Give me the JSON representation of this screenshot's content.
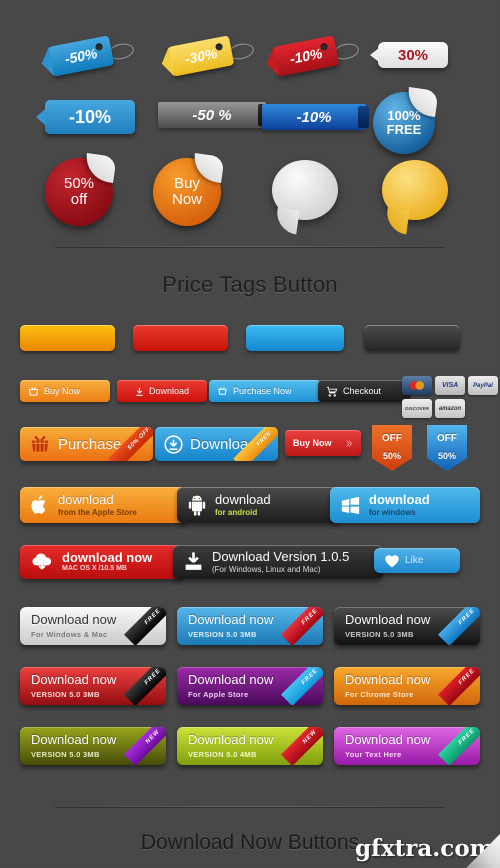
{
  "page": {
    "background_color": "#474747",
    "section_title_1": "Price Tags Button",
    "section_title_2": "Download Now Buttons",
    "watermark": "gfxtra.com"
  },
  "price_tags_row1": [
    {
      "label": "-50%",
      "color": "#1b8ed1",
      "type": "swing-tag"
    },
    {
      "label": "-30%",
      "color": "#f5cf3e",
      "type": "swing-tag"
    },
    {
      "label": "-10%",
      "color": "#cf1a22",
      "type": "swing-tag"
    },
    {
      "label": "30%",
      "color": "#ffffff",
      "type": "callout",
      "text_color": "#b0141c"
    }
  ],
  "price_tags_row2": [
    {
      "label": "-10%",
      "color": "#2a92d6",
      "type": "flag"
    },
    {
      "label": "-50 %",
      "color": "#6e6e6e",
      "type": "ribbon-band"
    },
    {
      "label": "-10%",
      "color": "#1763c9",
      "type": "ribbon-band"
    },
    {
      "label": "100% FREE",
      "color": "#1d6fb8",
      "type": "round-sticker"
    }
  ],
  "price_tags_row3": [
    {
      "label": "50% off",
      "color": "#a8101a",
      "type": "round-sticker"
    },
    {
      "label": "Buy Now",
      "color": "#e8750f",
      "type": "round-sticker"
    },
    {
      "label": "",
      "color": "#f2f2f2",
      "type": "speech-bubble"
    },
    {
      "label": "",
      "color": "#f5c53b",
      "type": "speech-bubble"
    }
  ],
  "plain_buttons": [
    {
      "name": "orange",
      "color": "#f7a708"
    },
    {
      "name": "red",
      "color": "#e22a20"
    },
    {
      "name": "blue",
      "color": "#24a7e8"
    },
    {
      "name": "dark",
      "color": "#3a3a3a"
    }
  ],
  "action_buttons": [
    {
      "label": "Buy Now",
      "icon": "basket-icon",
      "color": "#f6921e"
    },
    {
      "label": "Download",
      "icon": "down-arrow-icon",
      "color": "#e42a21"
    },
    {
      "label": "Purchase Now",
      "icon": "cart-icon",
      "color": "#33ade4"
    },
    {
      "label": "Checkout",
      "icon": "cart-icon",
      "color": "#2b2b2b"
    }
  ],
  "payment_cards": [
    {
      "label": "MasterCard",
      "short": "MC"
    },
    {
      "label": "VISA",
      "short": "VISA"
    },
    {
      "label": "PayPal",
      "short": "PayPal"
    },
    {
      "label": "DISCOVER",
      "short": "DISCOVER"
    },
    {
      "label": "amazon",
      "short": "amazon"
    }
  ],
  "ribbon_buttons": [
    {
      "label": "Purchase",
      "corner": "50% OFF",
      "color": "#f5951d",
      "corner_color": "#e03a17",
      "icon": "basket-icon"
    },
    {
      "label": "Download",
      "corner": "FREE",
      "color": "#2c9ee0",
      "corner_color": "#f39c12",
      "icon": "download-circle-icon"
    }
  ],
  "buy_now_arrow": {
    "label": "Buy Now",
    "icon": "chevron-right-icon",
    "color": "#e03131"
  },
  "pennants": [
    {
      "top": "OFF",
      "bottom": "50%",
      "color": "#e8561e"
    },
    {
      "top": "OFF",
      "bottom": "50%",
      "color": "#2b8fe0"
    }
  ],
  "platform_buttons": [
    {
      "line1": "download",
      "line2": "from the Apple Store",
      "icon": "apple-icon",
      "color": "#f5a11c",
      "line2_color": "#7a3c00"
    },
    {
      "line1": "download",
      "line2": "for android",
      "icon": "android-icon",
      "color": "#2d2d2d",
      "line2_color": "#c6e34a"
    },
    {
      "line1": "download",
      "line2": "for windows",
      "icon": "windows-icon",
      "color": "#35a9e8",
      "line2_color": "#11486e"
    }
  ],
  "download_row": [
    {
      "line1": "download now",
      "line2": "MAC OS X /10.5 MB",
      "icon": "cloud-download-icon",
      "color": "#e02020"
    },
    {
      "line1": "Download Version 1.0.5",
      "line2": "(For Windows, Linux and Mac)",
      "icon": "download-tray-icon",
      "color": "#2e2e2e"
    },
    {
      "line1": "Like",
      "line2": "",
      "icon": "heart-icon",
      "color": "#2e9fe0"
    }
  ],
  "download_now_buttons": [
    {
      "line1": "Download now",
      "line2": "For Windows & Mac",
      "color": "#f0f0f0",
      "color2": "#cfcfcf",
      "text_color": "#333333",
      "sub_color": "#777777",
      "corner": "FREE",
      "corner_color": "#1d1d1d"
    },
    {
      "line1": "Download now",
      "line2": "VERSION 5.0 3MB",
      "color": "#35a1e0",
      "color2": "#1b7ab8",
      "text_color": "#ffffff",
      "sub_color": "#dff0fb",
      "corner": "FREE",
      "corner_color": "#d4152a"
    },
    {
      "line1": "Download now",
      "line2": "VERSION 5.0 3MB",
      "color": "#3a3a3a",
      "color2": "#151515",
      "text_color": "#ffffff",
      "sub_color": "#cccccc",
      "corner": "FREE",
      "corner_color": "#2a94e0"
    },
    {
      "line1": "Download now",
      "line2": "VERSION 5.0 3MB",
      "color": "#e02b2b",
      "color2": "#9d0c10",
      "text_color": "#ffffff",
      "sub_color": "#ffd9d9",
      "corner": "FREE",
      "corner_color": "#1d1d1d"
    },
    {
      "line1": "Download now",
      "line2": "For Apple Store",
      "color": "#8a1f96",
      "color2": "#4f0a5e",
      "text_color": "#ffffff",
      "sub_color": "#f0cdf5",
      "corner": "FREE",
      "corner_color": "#2ab4ef"
    },
    {
      "line1": "Download now",
      "line2": "For Chrome Store",
      "color": "#f59a1e",
      "color2": "#d96b06",
      "text_color": "#ffffff",
      "sub_color": "#ffe8c9",
      "corner": "FREE",
      "corner_color": "#cf1320"
    },
    {
      "line1": "Download now",
      "line2": "VERSION 5.0 3MB",
      "color": "#8a9612",
      "color2": "#4e5406",
      "text_color": "#ffffff",
      "sub_color": "#e7eec0",
      "corner": "NEW",
      "corner_color": "#9416c4"
    },
    {
      "line1": "Download now",
      "line2": "VERSION 5.0 4MB",
      "color": "#c2d62a",
      "color2": "#8aa40c",
      "text_color": "#ffffff",
      "sub_color": "#f4fad0",
      "corner": "NEW",
      "corner_color": "#d4121f"
    },
    {
      "line1": "Download now",
      "line2": "Your Text Here",
      "color": "#d455d8",
      "color2": "#a21fb0",
      "text_color": "#ffffff",
      "sub_color": "#fbdcfb",
      "corner": "FREE",
      "corner_color": "#17c08a"
    }
  ]
}
